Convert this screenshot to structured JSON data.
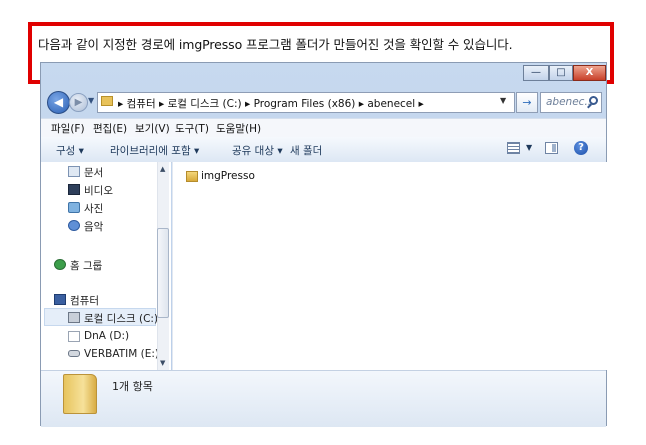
{
  "callout": {
    "text": "다음과 같이 지정한 경로에 imgPresso 프로그램 폴더가 만들어진 것을 확인할 수 있습니다."
  },
  "window": {
    "controls": {
      "minimize": "—",
      "maximize": "□",
      "close": "X"
    }
  },
  "address": {
    "breadcrumbs": [
      "컴퓨터",
      "로컬 디스크 (C:)",
      "Program Files (x86)",
      "abenecel"
    ],
    "separator": "▸"
  },
  "search": {
    "placeholder": "abenec..."
  },
  "menubar": [
    "파일(F)",
    "편집(E)",
    "보기(V)",
    "도구(T)",
    "도움말(H)"
  ],
  "commandbar": {
    "organize": "구성 ▾",
    "include_library": "라이브러리에 포함 ▾",
    "share_with": "공유 대상 ▾",
    "new_folder": "새 폴더"
  },
  "navpane": {
    "items": [
      "문서",
      "비디오",
      "사진",
      "음악",
      "홈 그룹",
      "컴퓨터",
      "로컬 디스크 (C:)",
      "DnA (D:)",
      "VERBATIM (E:)"
    ]
  },
  "files": [
    {
      "name": "imgPresso",
      "icon": "folder-icon"
    }
  ],
  "details": {
    "count": "1개 항목"
  },
  "colors": {
    "callout_border": "#e00000",
    "close_button": "#c8402a",
    "folder": "#e8c25a"
  }
}
